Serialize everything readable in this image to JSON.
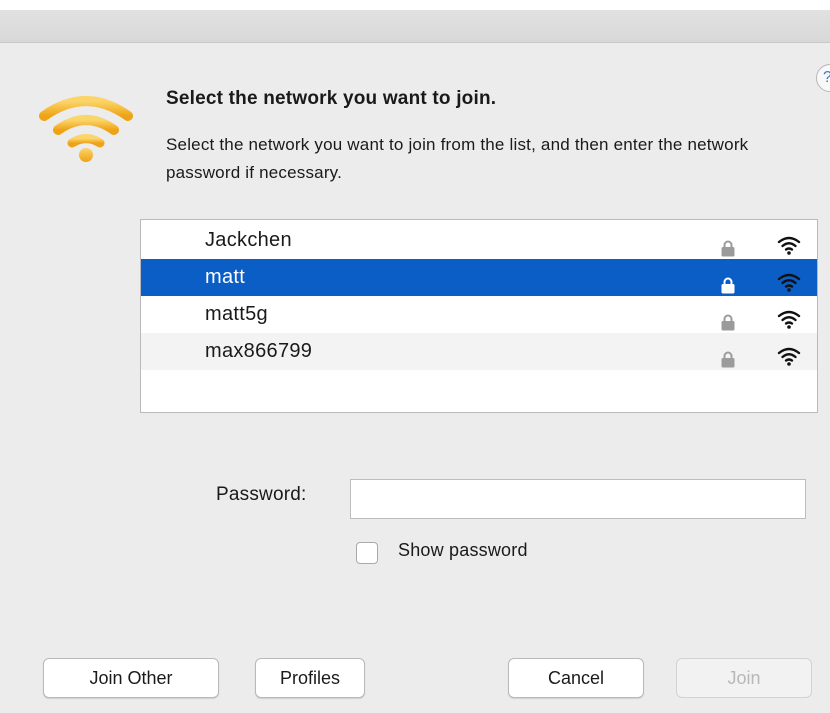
{
  "dialog": {
    "title": "Select the network you want to join.",
    "description": "Select the network you want to join from the list, and then enter the network password if necessary.",
    "help_label": "?"
  },
  "networks": [
    {
      "name": "Jackchen",
      "secured": true,
      "selected": false,
      "icon": "lock-icon",
      "signal_icon": "wifi-signal-icon"
    },
    {
      "name": "matt",
      "secured": true,
      "selected": true,
      "icon": "lock-icon",
      "signal_icon": "wifi-signal-icon"
    },
    {
      "name": "matt5g",
      "secured": true,
      "selected": false,
      "icon": "lock-icon",
      "signal_icon": "wifi-signal-icon"
    },
    {
      "name": "max866799",
      "secured": true,
      "selected": false,
      "icon": "lock-icon",
      "signal_icon": "wifi-signal-icon"
    }
  ],
  "password": {
    "label": "Password:",
    "value": "",
    "placeholder": "",
    "show_password_label": "Show password",
    "show_password_checked": false
  },
  "buttons": {
    "join_other": "Join Other",
    "profiles": "Profiles",
    "cancel": "Cancel",
    "join": "Join"
  },
  "colors": {
    "selection": "#0a5ec6",
    "wifi_logo": "#f5b427",
    "background": "#ececec"
  }
}
